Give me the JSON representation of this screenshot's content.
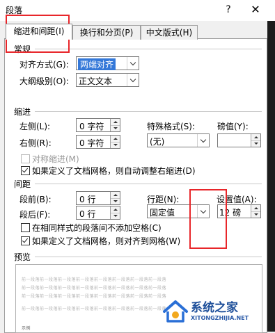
{
  "window": {
    "title": "段落",
    "help_label": "?",
    "close_label": "✕"
  },
  "tabs": [
    {
      "label": "缩进和间距(I)",
      "active": true
    },
    {
      "label": "换行和分页(P)",
      "active": false
    },
    {
      "label": "中文版式(H)",
      "active": false
    }
  ],
  "general": {
    "title": "常规",
    "alignment": {
      "label": "对齐方式(G):",
      "value": "两端对齐"
    },
    "outline": {
      "label": "大纲级别(O):",
      "value": "正文文本"
    }
  },
  "indent": {
    "title": "缩进",
    "left": {
      "label": "左侧(L):",
      "value": "0 字符"
    },
    "right": {
      "label": "右侧(R):",
      "value": "0 字符"
    },
    "special": {
      "label": "特殊格式(S):",
      "value": "(无)"
    },
    "by": {
      "label": "磅值(Y):",
      "value": ""
    },
    "mirror": {
      "label": "对称缩进(M)",
      "checked": false,
      "disabled": true
    },
    "auto_adjust": {
      "label": "如果定义了文档网格，则自动调整右缩进(D)",
      "checked": true
    }
  },
  "spacing": {
    "title": "间距",
    "before": {
      "label": "段前(B):",
      "value": "0 行"
    },
    "after": {
      "label": "段后(F):",
      "value": "0 行"
    },
    "line_spacing": {
      "label": "行距(N):",
      "value": "固定值"
    },
    "at": {
      "label": "设置值(A):",
      "value": "12 磅"
    },
    "no_space_same_style": {
      "label": "在相同样式的段落间不添加空格(C)",
      "checked": false
    },
    "snap_to_grid": {
      "label": "如果定义了文档网格，则对齐到网格(W)",
      "checked": true
    }
  },
  "preview": {
    "title": "预览",
    "sample_line": "前一段落前一段落前一段落前一段落前一段落前一段落前一段落前一段落",
    "sample_word": "示例"
  },
  "watermark": {
    "text": "系统之家",
    "url": "XITONGZHIJIA.NET"
  },
  "colors": {
    "highlight": "#e8262a",
    "selection": "#3478d8"
  }
}
